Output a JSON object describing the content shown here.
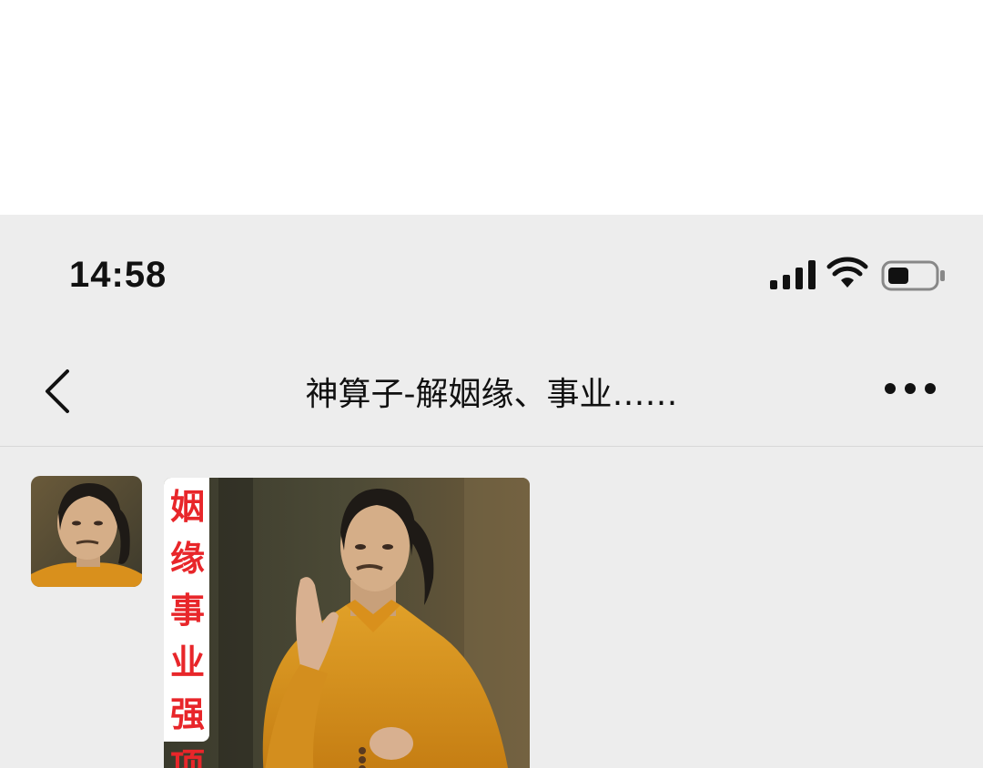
{
  "status_bar": {
    "time": "14:58",
    "icons": [
      "signal-icon",
      "wifi-icon",
      "battery-icon"
    ]
  },
  "nav": {
    "title": "神算子-解姻缘、事业……",
    "back_icon": "chevron-left-icon",
    "more_icon": "more-icon"
  },
  "chat": {
    "message_image": {
      "banner_text": "姻缘事业强项"
    }
  },
  "colors": {
    "background": "#ededed",
    "banner_text": "#e8262a",
    "robe": "#d9901c"
  }
}
